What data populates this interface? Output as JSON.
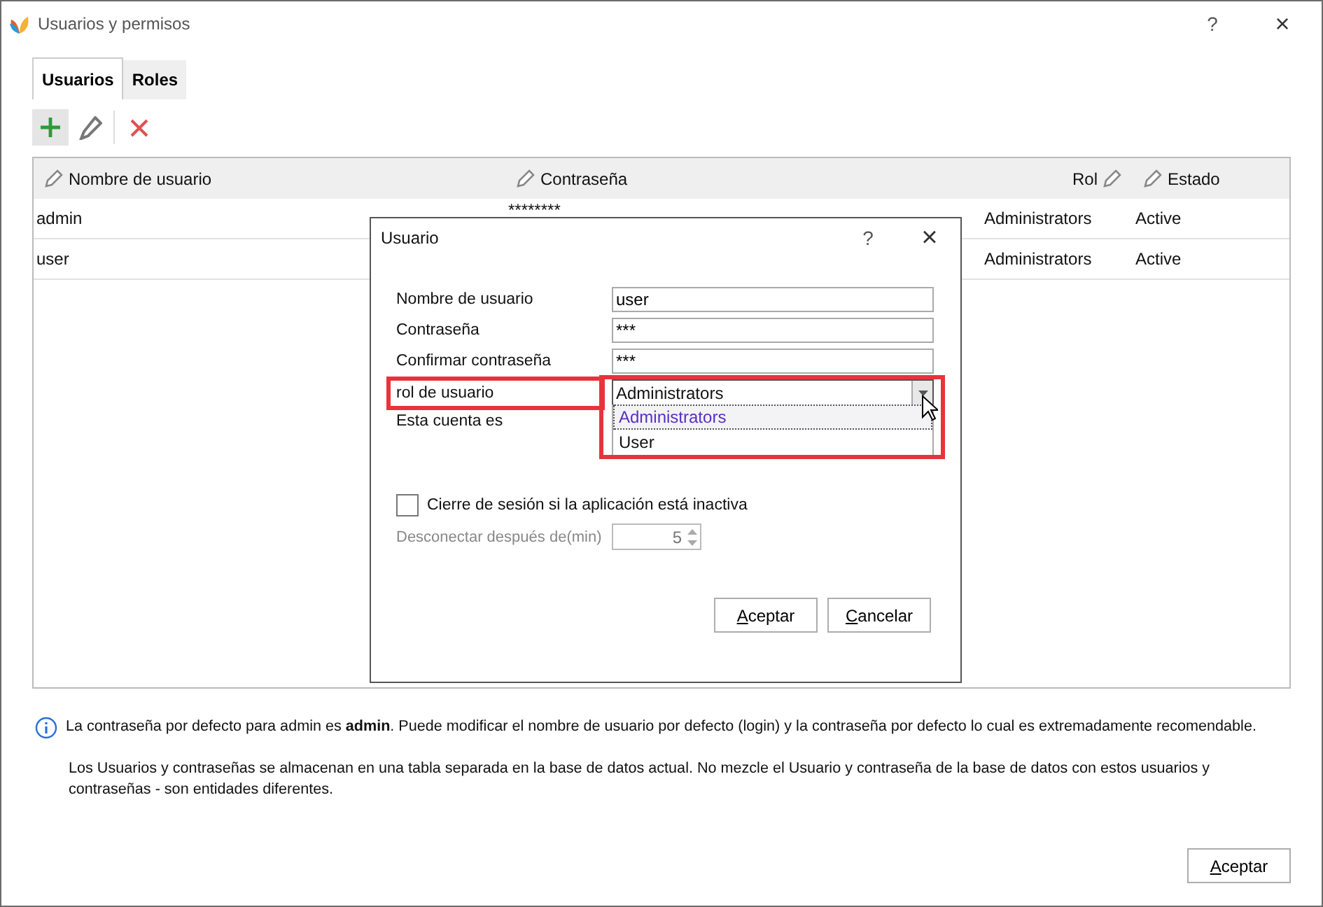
{
  "window": {
    "title": "Usuarios y permisos",
    "help": "?",
    "close": "×"
  },
  "tabs": [
    {
      "label": "Usuarios",
      "selected": true
    },
    {
      "label": "Roles",
      "selected": false
    }
  ],
  "toolbar": [
    {
      "kind": "add",
      "hovered": true
    },
    {
      "kind": "edit",
      "hovered": false
    },
    {
      "kind": "delete",
      "hovered": false
    }
  ],
  "table": {
    "columns": [
      {
        "label": "Nombre de usuario",
        "kind": "leading_icon"
      },
      {
        "label": "Contraseña",
        "kind": "leading_icon"
      },
      {
        "label": "Rol",
        "kind": "trailing_icon"
      },
      {
        "label": "Estado",
        "kind": "leading_icon"
      }
    ],
    "rows": [
      [
        "admin",
        "********",
        "Administrators",
        "Active"
      ],
      [
        "user",
        "",
        "Administrators",
        "Active"
      ]
    ]
  },
  "dialog": {
    "title": "Usuario",
    "help": "?",
    "close": "×",
    "fields": [
      {
        "label": "Nombre de usuario",
        "value": "user"
      },
      {
        "label": "Contraseña",
        "value": "***"
      },
      {
        "label": "Confirmar contraseña",
        "value": "***"
      }
    ],
    "role": {
      "label": "rol de usuario",
      "value": "Administrators",
      "open": true,
      "highlighted": true,
      "options": [
        {
          "label": "Administrators",
          "selected": true
        },
        {
          "label": "User",
          "selected": false
        }
      ]
    },
    "account_label": "Esta cuenta es",
    "logout": {
      "label": "Cierre de sesión si la aplicación está inactiva",
      "checked": false
    },
    "timeout": {
      "label": "Desconectar después de(min)",
      "value": "5",
      "disabled": true
    },
    "buttons": [
      "Aceptar",
      "Cancelar"
    ]
  },
  "notes": [
    "La contraseña por defecto para admin es **admin**. Puede modificar el nombre de usuario por defecto (login) y la contraseña por defecto lo cual es extremadamente recomendable.",
    "Los Usuarios y contraseñas se almacenan en una tabla separada en la base de datos actual. No mezcle el Usuario y contraseña de la base de datos con estos usuarios y contraseñas - son entidades diferentes."
  ],
  "footer_button": "Aceptar"
}
